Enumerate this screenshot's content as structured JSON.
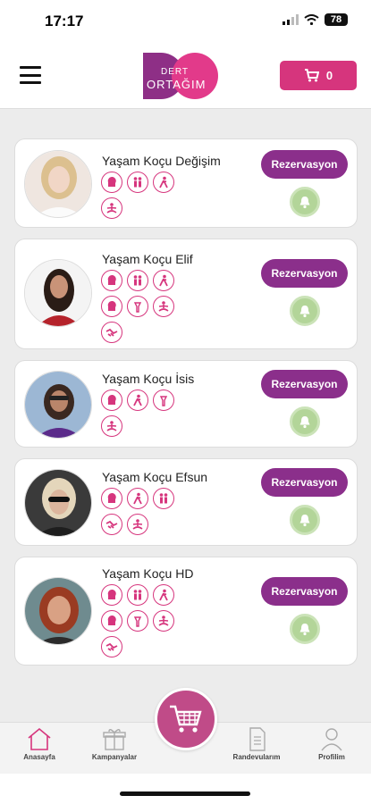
{
  "status": {
    "time": "17:17",
    "battery": "78"
  },
  "header": {
    "logo_text_top": "DERT",
    "logo_text_bottom": "ORTAĞIM",
    "cart_count": "0",
    "brand_color": "#d6357d"
  },
  "coaches": [
    {
      "name": "Yaşam Koçu Değişim",
      "reserve_label": "Rezervasyon",
      "icons": [
        "head-icon",
        "couple-icon",
        "walking-icon",
        "meditation-icon"
      ]
    },
    {
      "name": "Yaşam Koçu Elif",
      "reserve_label": "Rezervasyon",
      "icons": [
        "head-icon",
        "couple-icon",
        "walking-icon",
        "head-icon",
        "torch-icon",
        "meditation-icon",
        "handshake-icon"
      ]
    },
    {
      "name": "Yaşam Koçu İsis",
      "reserve_label": "Rezervasyon",
      "icons": [
        "head-icon",
        "walking-icon",
        "torch-icon",
        "meditation-icon"
      ]
    },
    {
      "name": "Yaşam Koçu Efsun",
      "reserve_label": "Rezervasyon",
      "icons": [
        "head-icon",
        "walking-icon",
        "couple-icon",
        "handshake-icon",
        "meditation-icon"
      ]
    },
    {
      "name": "Yaşam Koçu HD",
      "reserve_label": "Rezervasyon",
      "icons": [
        "head-icon",
        "couple-icon",
        "walking-icon",
        "head-icon",
        "torch-icon",
        "meditation-icon",
        "handshake-icon"
      ]
    }
  ],
  "nav": {
    "home": "Anasayfa",
    "campaigns": "Kampanyalar",
    "appointments": "Randevularım",
    "profile": "Profilim"
  },
  "colors": {
    "reserve": "#8b2f8b",
    "bell": "#b3d599",
    "icon_stroke": "#d6357d",
    "center_cart": "#c04b88"
  }
}
